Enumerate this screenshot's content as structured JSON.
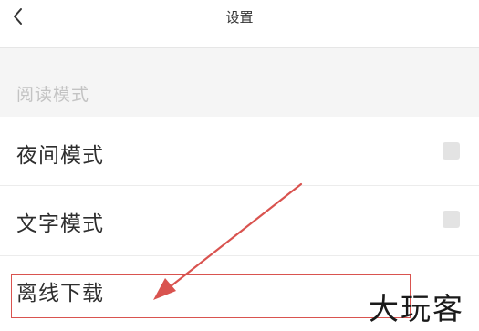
{
  "nav": {
    "back_icon": "chevron-left-icon",
    "title": "设置"
  },
  "section": {
    "header": "阅读模式"
  },
  "rows": [
    {
      "label": "夜间模式",
      "control": "checkbox",
      "checked": false
    },
    {
      "label": "文字模式",
      "control": "checkbox",
      "checked": false
    },
    {
      "label": "离线下载",
      "control": "none"
    }
  ],
  "annotation": {
    "color": "#d9534f",
    "arrow_target": "离线下载"
  },
  "watermark": "大玩客"
}
